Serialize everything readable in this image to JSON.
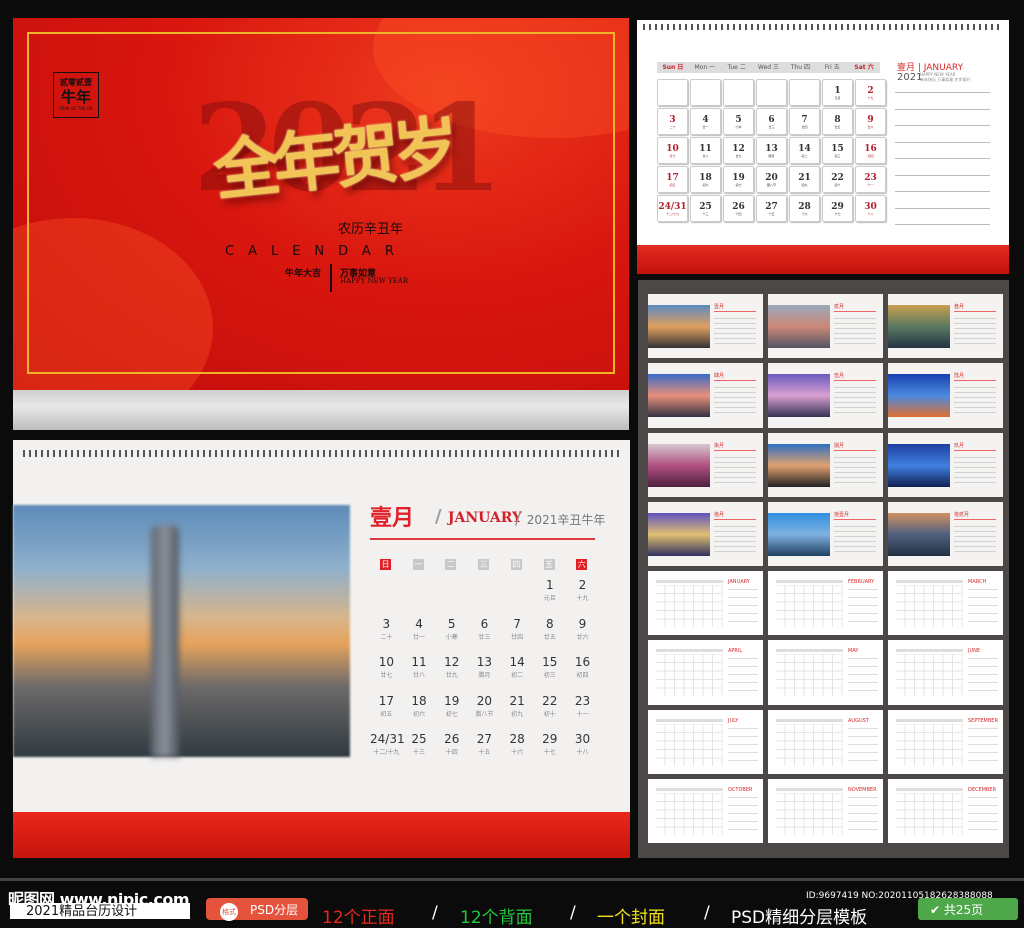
{
  "cover": {
    "stamp_top": "贰零贰壹",
    "stamp_main": "牛年",
    "stamp_en": "YEAR OF THE OX",
    "bg_year": "2021",
    "headline": "全年贺岁",
    "lunar_year": "农历辛丑年",
    "calendar_word": "CALENDAR",
    "blessing_left": "牛年大吉",
    "blessing_right": "万事如意",
    "happy_new_year": "HAPPY NEW YEAR"
  },
  "back_page": {
    "weekdays": [
      "Sun 日",
      "Mon 一",
      "Tue 二",
      "Wed 三",
      "Thu 四",
      "Fri 五",
      "Sat 六"
    ],
    "month_cn": "壹月",
    "month_en": "JANUARY",
    "year": "2021",
    "happy_new_year": "HAPPY NEW YEAR",
    "blessing": "新年快乐 万事如意 步步高升"
  },
  "front_page": {
    "month_cn": "壹月",
    "month_en": "JANUARY",
    "year_label": "2021辛丑牛年",
    "weekdays": [
      "日",
      "一",
      "二",
      "三",
      "四",
      "五",
      "六"
    ],
    "days": [
      {
        "d": "",
        "l": ""
      },
      {
        "d": "",
        "l": ""
      },
      {
        "d": "",
        "l": ""
      },
      {
        "d": "",
        "l": ""
      },
      {
        "d": "",
        "l": ""
      },
      {
        "d": "1",
        "l": "元旦"
      },
      {
        "d": "2",
        "l": "十九"
      },
      {
        "d": "3",
        "l": "二十"
      },
      {
        "d": "4",
        "l": "廿一"
      },
      {
        "d": "5",
        "l": "小寒"
      },
      {
        "d": "6",
        "l": "廿三"
      },
      {
        "d": "7",
        "l": "廿四"
      },
      {
        "d": "8",
        "l": "廿五"
      },
      {
        "d": "9",
        "l": "廿六"
      },
      {
        "d": "10",
        "l": "廿七"
      },
      {
        "d": "11",
        "l": "廿八"
      },
      {
        "d": "12",
        "l": "廿九"
      },
      {
        "d": "13",
        "l": "腊月"
      },
      {
        "d": "14",
        "l": "初二"
      },
      {
        "d": "15",
        "l": "初三"
      },
      {
        "d": "16",
        "l": "初四"
      },
      {
        "d": "17",
        "l": "初五"
      },
      {
        "d": "18",
        "l": "初六"
      },
      {
        "d": "19",
        "l": "初七"
      },
      {
        "d": "20",
        "l": "腊八节"
      },
      {
        "d": "21",
        "l": "初九"
      },
      {
        "d": "22",
        "l": "初十"
      },
      {
        "d": "23",
        "l": "十一"
      },
      {
        "d": "24/31",
        "l": "十二/十九"
      },
      {
        "d": "25",
        "l": "十三"
      },
      {
        "d": "26",
        "l": "十四"
      },
      {
        "d": "27",
        "l": "十五"
      },
      {
        "d": "28",
        "l": "十六"
      },
      {
        "d": "29",
        "l": "十七"
      },
      {
        "d": "30",
        "l": "十八"
      }
    ]
  },
  "thumbnails": {
    "months_cn": [
      "壹月",
      "贰月",
      "叁月",
      "肆月",
      "伍月",
      "陆月",
      "柒月",
      "捌月",
      "玖月",
      "拾月",
      "拾壹月",
      "拾贰月"
    ],
    "months_en": [
      "JANUARY",
      "FEBRUARY",
      "MARCH",
      "APRIL",
      "MAY",
      "JUNE",
      "JULY",
      "AUGUST",
      "SEPTEMBER",
      "OCTOBER",
      "NOVEMBER",
      "DECEMBER"
    ]
  },
  "footer": {
    "logo": "昵图网 www.nipic.com",
    "id": "ID:9697419 NO:20201105182628388088",
    "title": "2021精品台历设计",
    "badge": "PSD分层",
    "badge_icon": "格式",
    "item1": "12个正面",
    "item2": "12个背面",
    "item3": "一个封面",
    "item4": "PSD精细分层模板",
    "sep": "/",
    "pages": "共25页",
    "colors": {
      "item1": "#e8281c",
      "item2": "#22c93a",
      "item3": "#f4e21a",
      "item4": "#ffffff"
    }
  }
}
